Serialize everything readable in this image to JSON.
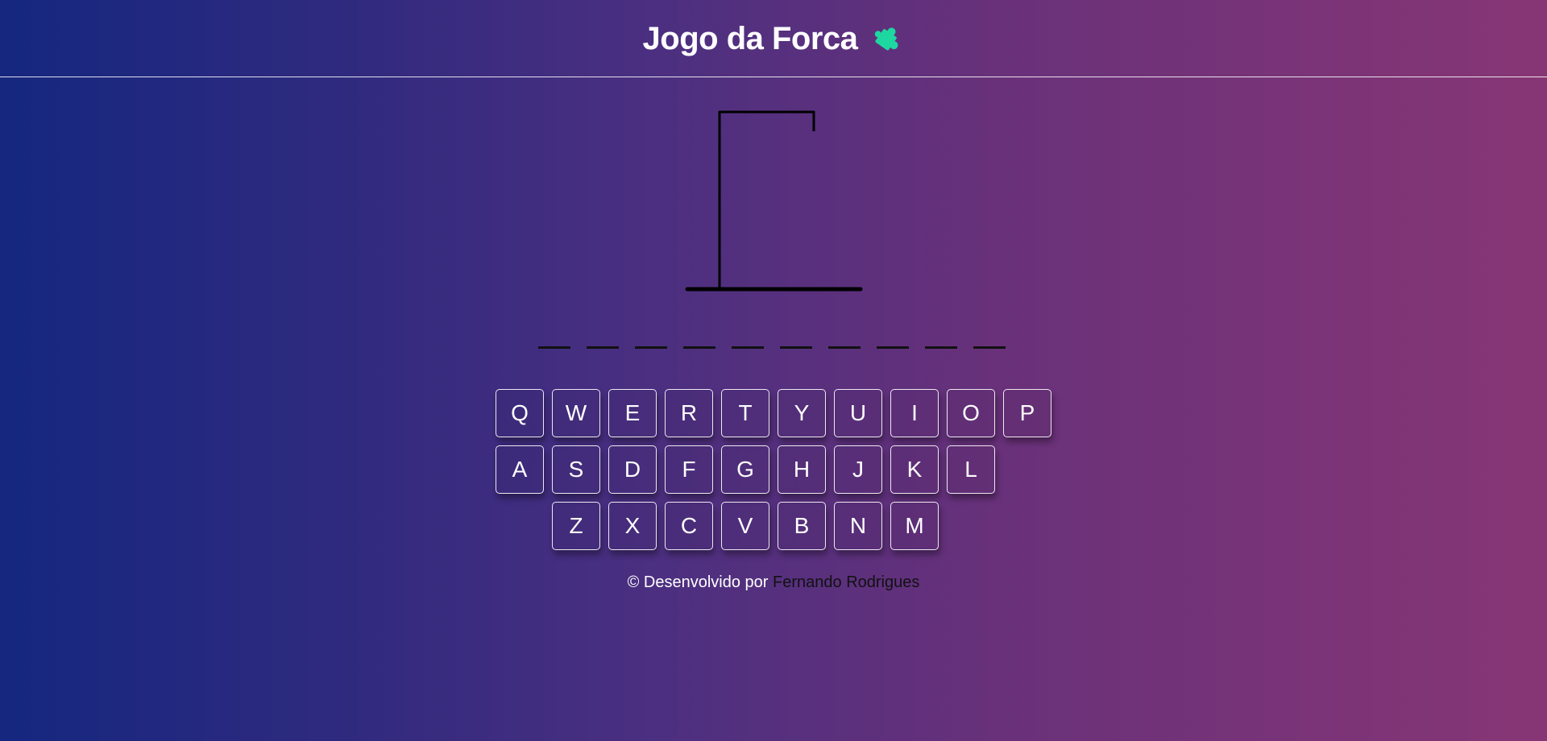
{
  "header": {
    "title": "Jogo da Forca"
  },
  "icons": {
    "title_icon": "puzzle-piece-icon",
    "title_icon_color": "#1ed7a0"
  },
  "game": {
    "word_slot_count": 10,
    "wrong_guesses": 0
  },
  "keyboard": {
    "rows": [
      [
        "Q",
        "W",
        "E",
        "R",
        "T",
        "Y",
        "U",
        "I",
        "O",
        "P"
      ],
      [
        "A",
        "S",
        "D",
        "F",
        "G",
        "H",
        "J",
        "K",
        "L"
      ],
      [
        "Z",
        "X",
        "C",
        "V",
        "B",
        "N",
        "M"
      ]
    ]
  },
  "footer": {
    "prefix": "© Desenvolvido por",
    "author": "Fernando Rodrigues"
  },
  "colors": {
    "gradient_start": "#15277f",
    "gradient_end": "#873675",
    "gallows": "#000000"
  }
}
